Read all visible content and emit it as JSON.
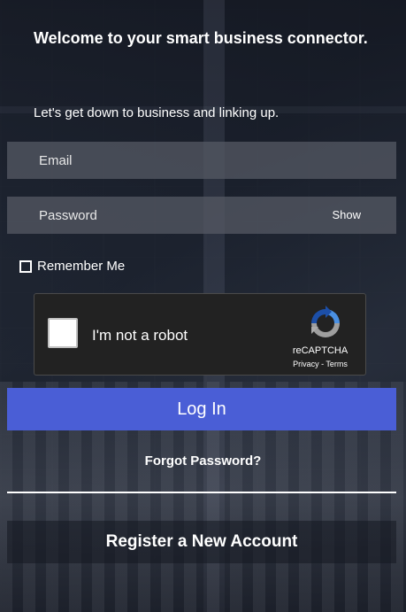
{
  "header": {
    "title": "Welcome to your smart business connector.",
    "subtitle": "Let's get down to business and linking up."
  },
  "form": {
    "email_placeholder": "Email",
    "password_placeholder": "Password",
    "show_label": "Show",
    "remember_label": "Remember Me"
  },
  "recaptcha": {
    "label": "I'm not a robot",
    "brand": "reCAPTCHA",
    "links": "Privacy - Terms"
  },
  "actions": {
    "login_label": "Log In",
    "forgot_label": "Forgot Password?",
    "register_label": "Register a New Account"
  },
  "colors": {
    "primary": "#4a5ed6",
    "field_bg": "#555a64",
    "recaptcha_bg": "#222222"
  }
}
